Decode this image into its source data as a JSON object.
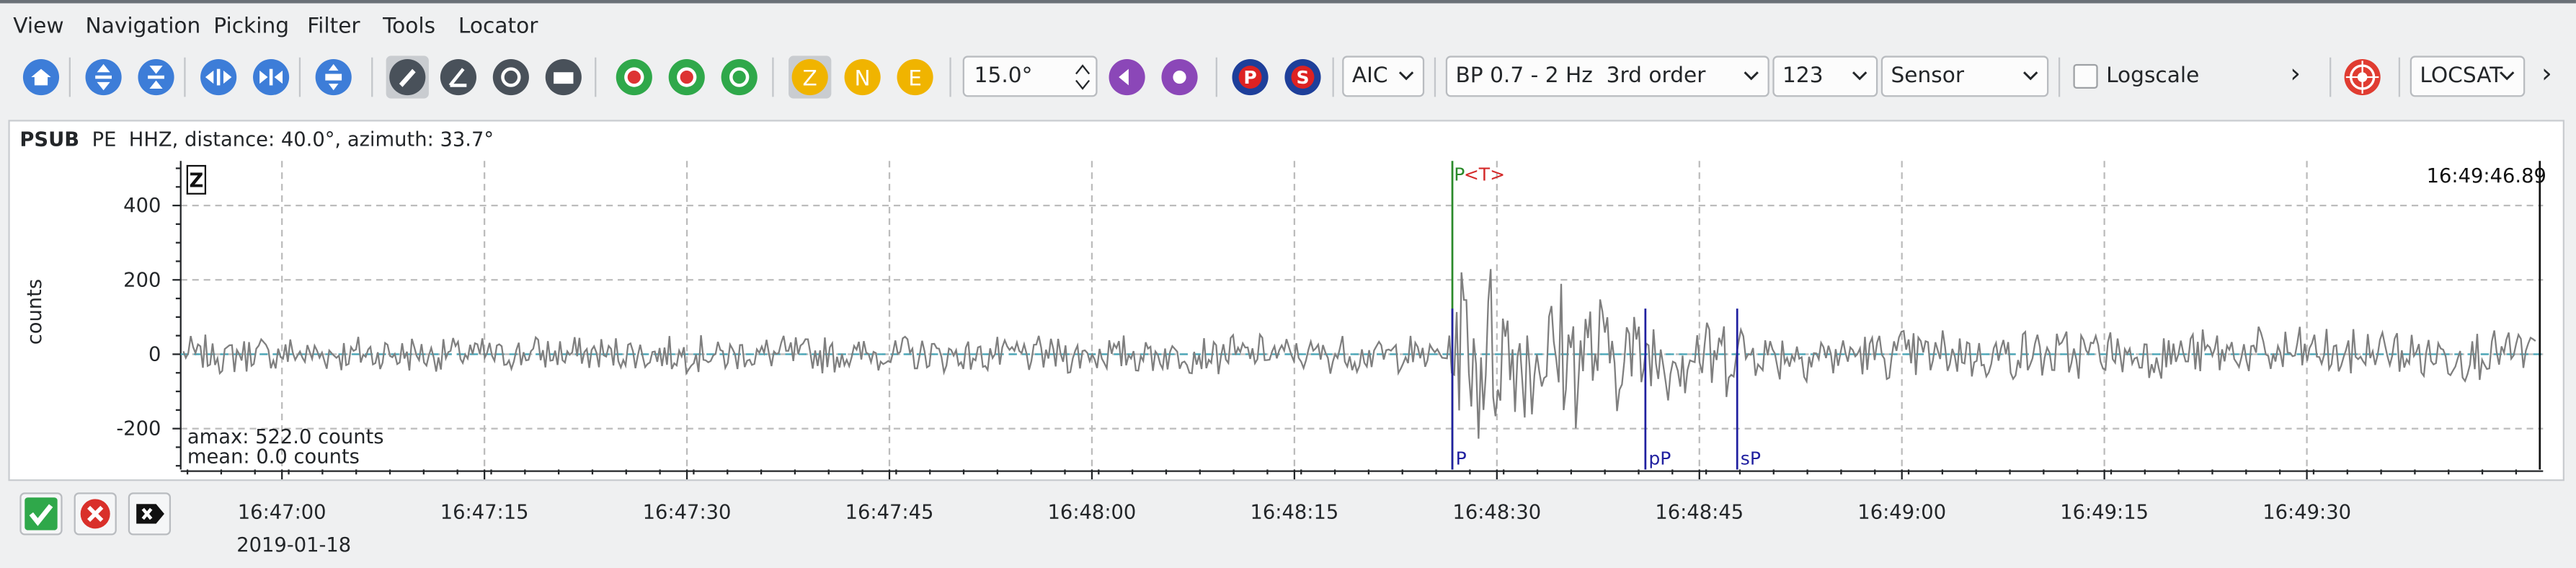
{
  "menu": [
    "View",
    "Navigation",
    "Picking",
    "Filter",
    "Tools",
    "Locator"
  ],
  "toolbar": {
    "component_buttons": [
      "Z",
      "N",
      "E"
    ],
    "phase_buttons": [
      "P",
      "S"
    ],
    "spin_value": "15.0°",
    "picker_method": "AIC",
    "filter": "BP 0.7 - 2 Hz  3rd order",
    "station_group": "123",
    "unit_mode": "Sensor",
    "logscale_label": "Logscale",
    "more_label": "›",
    "locator": "LOCSAT",
    "more2_label": "›"
  },
  "trace": {
    "station": "PSUB",
    "network": "PE",
    "channel_info": "HHZ, distance: 40.0°, azimuth: 33.7°",
    "component": "Z",
    "time_readout": "16:49:46.89",
    "ylabel": "counts",
    "amax": "amax: 522.0 counts",
    "mean": "mean: 0.0 counts",
    "date": "2019-01-18",
    "colors": {
      "trace": "#7f7f7f",
      "pick_p": "#2a8a2a",
      "theory": "#d42a2a",
      "phase": "#2020a0"
    }
  },
  "chart_data": {
    "type": "line",
    "xlabel": "",
    "ylabel": "counts",
    "y_ticks": [
      400,
      200,
      0,
      -200
    ],
    "ylim": [
      -310,
      520
    ],
    "x_ticks": [
      "16:47:00",
      "16:47:15",
      "16:47:30",
      "16:47:45",
      "16:48:00",
      "16:48:15",
      "16:48:30",
      "16:48:45",
      "16:49:00",
      "16:49:15",
      "16:49:30"
    ],
    "xlim_seconds_from_first_tick": [
      -7.5,
      167.5
    ],
    "picks": [
      {
        "label": "P",
        "seconds": 86.7,
        "kind": "pick"
      },
      {
        "label": "<T>",
        "seconds": 87.3,
        "kind": "theory"
      },
      {
        "label": "P",
        "seconds": 86.7,
        "kind": "phase"
      },
      {
        "label": "pP",
        "seconds": 101.0,
        "kind": "phase"
      },
      {
        "label": "sP",
        "seconds": 107.8,
        "kind": "phase"
      }
    ],
    "grid": true
  }
}
